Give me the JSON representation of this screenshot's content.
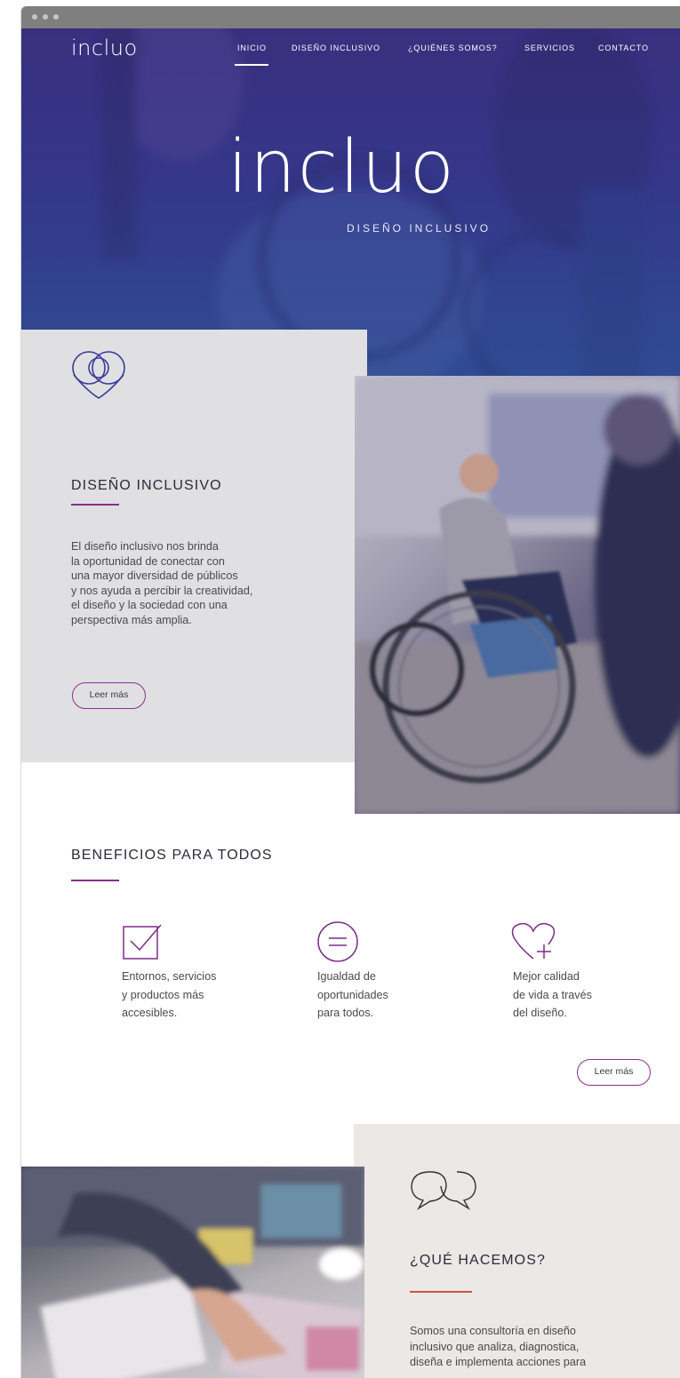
{
  "brand": {
    "logo": "incluo",
    "tagline": "DISEÑO INCLUSIVO"
  },
  "nav": {
    "items": [
      {
        "label": "INICIO",
        "active": true
      },
      {
        "label": "DISEÑO INCLUSIVO"
      },
      {
        "label": "¿QUIÉNES SOMOS?"
      },
      {
        "label": "SERVICIOS"
      },
      {
        "label": "CONTACTO"
      }
    ]
  },
  "inclusive": {
    "icon": "intertwined-rings-heart-icon",
    "title": "DISEÑO INCLUSIVO",
    "lines": [
      "El diseño inclusivo nos brinda",
      "la oportunidad de conectar con",
      "una mayor diversidad de públicos",
      "y nos ayuda a percibir la creatividad,",
      "el diseño y la sociedad con una",
      "perspectiva más amplia."
    ],
    "button": "Leer más"
  },
  "benefits": {
    "title": "BENEFICIOS PARA TODOS",
    "items": [
      {
        "icon": "checkbox-icon",
        "lines": [
          "Entornos, servicios",
          "y productos más",
          "accesibles."
        ]
      },
      {
        "icon": "equals-circle-icon",
        "lines": [
          "Igualdad de",
          "oportunidades",
          "para todos."
        ]
      },
      {
        "icon": "heart-plus-icon",
        "lines": [
          "Mejor calidad",
          "de vida a través",
          "del diseño."
        ]
      }
    ],
    "button": "Leer más"
  },
  "whatwedo": {
    "icon": "speech-bubbles-icon",
    "title": "¿QUÉ HACEMOS?",
    "lines": [
      "Somos una consultoría en diseño",
      "inclusivo que analiza, diagnostica,",
      "diseña e implementa acciones para"
    ]
  },
  "colors": {
    "accent": "#8c2f88",
    "hero": "#35378a",
    "panel": "#e0e0e2",
    "panel_warm": "#ebe8e5",
    "rule_warm": "#d0523c"
  }
}
